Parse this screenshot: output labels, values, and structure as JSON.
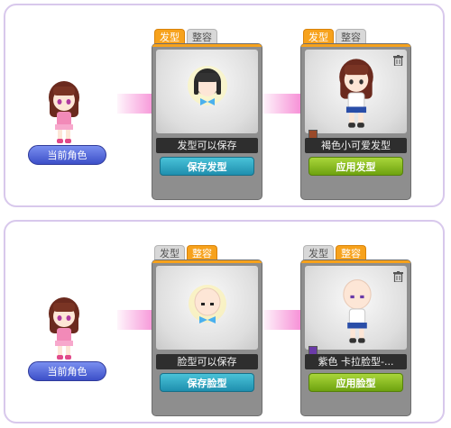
{
  "hair_section": {
    "current_role_label": "当前角色",
    "save_card": {
      "tabs": [
        "发型",
        "整容"
      ],
      "active_tab": "发型",
      "status_text": "发型可以保存",
      "button_label": "保存发型"
    },
    "apply_card": {
      "tabs": [
        "发型",
        "整容"
      ],
      "active_tab": "发型",
      "item_name": "褐色小可爱发型",
      "button_label": "应用发型",
      "swatch_color": "#9a4a2a"
    }
  },
  "face_section": {
    "current_role_label": "当前角色",
    "save_card": {
      "tabs": [
        "发型",
        "整容"
      ],
      "active_tab": "整容",
      "status_text": "脸型可以保存",
      "button_label": "保存脸型"
    },
    "apply_card": {
      "tabs": [
        "发型",
        "整容"
      ],
      "active_tab": "整容",
      "item_name": "紫色 卡拉脸型-...",
      "button_label": "应用脸型",
      "swatch_color": "#6a3aa8"
    }
  },
  "colors": {
    "panel_border": "#d8c8ec",
    "active_tab": "#f7a21c",
    "save_button": "#1f8fae",
    "apply_button": "#6ea20f",
    "arrow": "#f03cb8"
  }
}
